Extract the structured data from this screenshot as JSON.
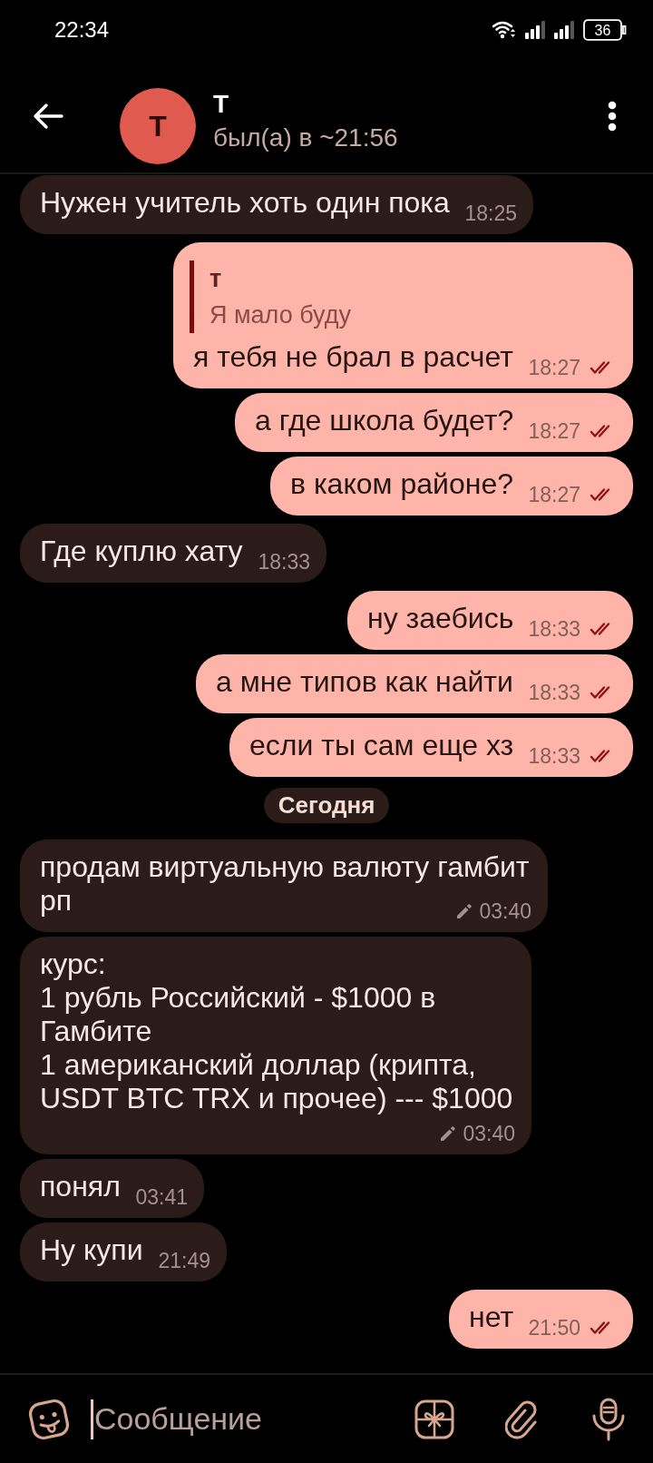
{
  "status_bar": {
    "time": "22:34",
    "battery": "36"
  },
  "chat_header": {
    "name": "Т",
    "avatar_letter": "Т",
    "last_seen": "был(а) в ~21:56"
  },
  "messages": [
    {
      "kind": "incoming",
      "text": "Нужен учитель хоть один пока",
      "time": "18:25",
      "edited": false
    },
    {
      "kind": "outgoing",
      "reply": {
        "name": "т",
        "text": "Я мало буду"
      },
      "text": "я тебя не брал в расчет",
      "time": "18:27",
      "edited": false,
      "read": true
    },
    {
      "kind": "outgoing",
      "text": "а где школа будет?",
      "time": "18:27",
      "edited": false,
      "read": true
    },
    {
      "kind": "outgoing",
      "text": "в каком районе?",
      "time": "18:27",
      "edited": false,
      "read": true
    },
    {
      "kind": "incoming",
      "text": "Где куплю хату",
      "time": "18:33",
      "edited": false
    },
    {
      "kind": "outgoing",
      "text": "ну заебись",
      "time": "18:33",
      "edited": false,
      "read": true
    },
    {
      "kind": "outgoing",
      "text": "а мне типов как найти",
      "time": "18:33",
      "edited": false,
      "read": true
    },
    {
      "kind": "outgoing",
      "text": "если ты сам еще хз",
      "time": "18:33",
      "edited": false,
      "read": true
    },
    {
      "kind": "date",
      "text": "Сегодня"
    },
    {
      "kind": "incoming",
      "text": "продам виртуальную валюту гамбит\nрп",
      "time": "03:40",
      "edited": true
    },
    {
      "kind": "incoming",
      "text": "курс:\n1 рубль Российский - $1000 в\nГамбите\n1 американский доллар (крипта,\nUSDT BTC TRX и прочее) --- $1000",
      "time": "03:40",
      "edited": true
    },
    {
      "kind": "incoming",
      "text": "понял",
      "time": "03:41",
      "edited": false
    },
    {
      "kind": "incoming",
      "text": "Ну купи",
      "time": "21:49",
      "edited": false
    },
    {
      "kind": "outgoing",
      "text": "нет",
      "time": "21:50",
      "edited": false,
      "read": true
    }
  ],
  "composer": {
    "placeholder": "Сообщение"
  }
}
